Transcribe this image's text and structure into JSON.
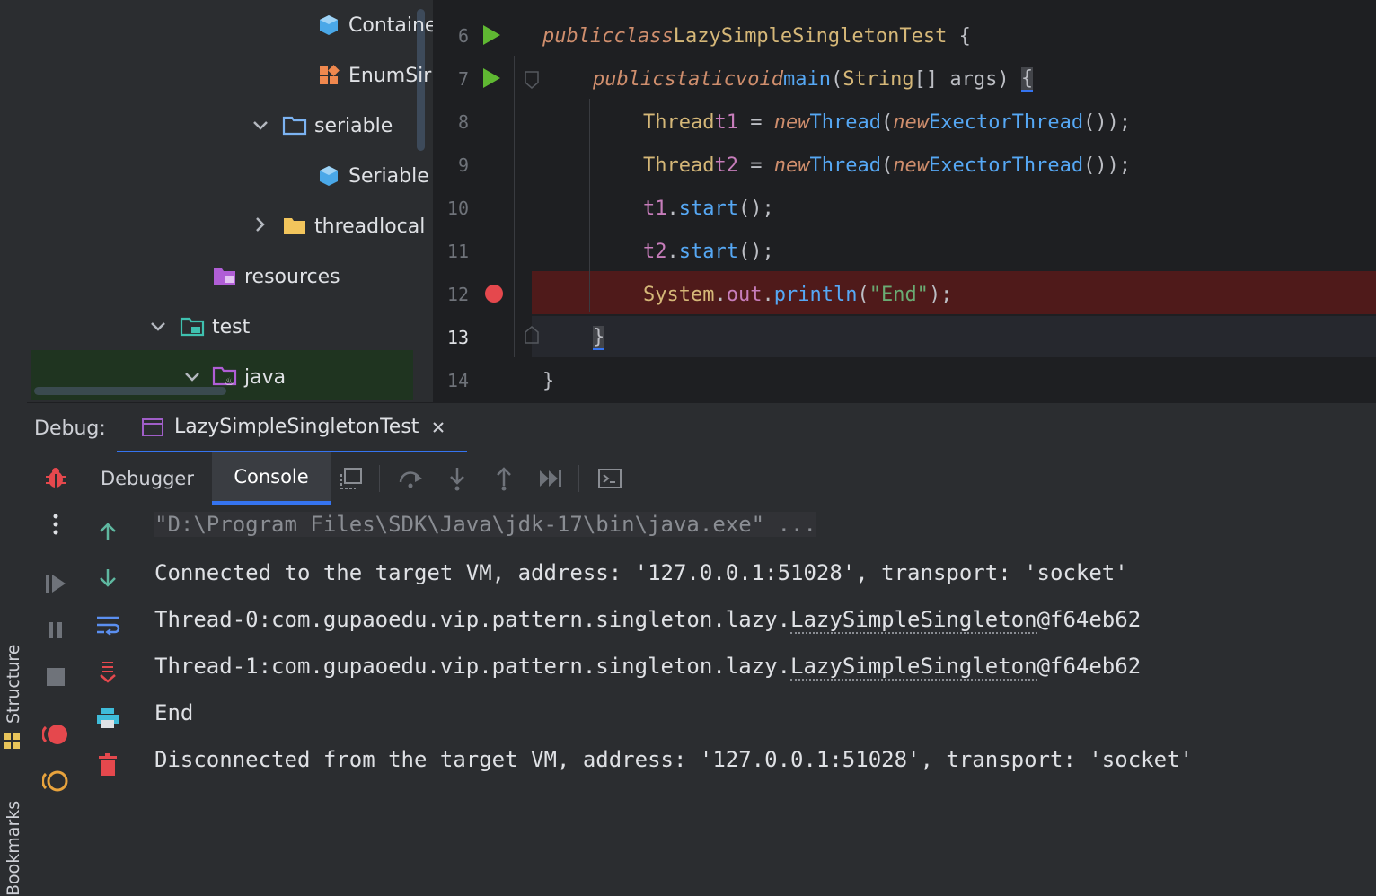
{
  "sidebar_stripe": {
    "structure_label": "Structure",
    "bookmarks_label": "Bookmarks"
  },
  "project_tree": {
    "items": [
      {
        "label": "Containe",
        "icon": "class-cube-icon"
      },
      {
        "label": "EnumSir",
        "icon": "enum-icon"
      },
      {
        "label": "seriable",
        "icon": "package-folder-icon"
      },
      {
        "label": "Seriable",
        "icon": "class-cube-icon"
      },
      {
        "label": "threadlocal",
        "icon": "folder-icon"
      },
      {
        "label": "resources",
        "icon": "resources-folder-icon"
      },
      {
        "label": "test",
        "icon": "test-folder-icon"
      },
      {
        "label": "java",
        "icon": "java-source-folder-icon"
      }
    ]
  },
  "editor": {
    "line_numbers": [
      "6",
      "7",
      "8",
      "9",
      "10",
      "11",
      "12",
      "13",
      "14"
    ],
    "lines": {
      "l6": {
        "kw1": "public",
        "kw2": "class",
        "name": "LazySimpleSingletonTest",
        "rest": " {"
      },
      "l7": {
        "kw1": "public",
        "kw2": "static",
        "kw3": "void",
        "fn": "main",
        "p1": "(",
        "type": "String",
        "p2": "[] args) ",
        "brace": "{"
      },
      "l8": {
        "type": "Thread",
        "var": "t1",
        "eq": " = ",
        "new1": "new",
        "ctor": "Thread",
        "p1": "(",
        "new2": "new",
        "arg": "ExectorThread",
        "p2": "());"
      },
      "l9": {
        "type": "Thread",
        "var": "t2",
        "eq": " = ",
        "new1": "new",
        "ctor": "Thread",
        "p1": "(",
        "new2": "new",
        "arg": "ExectorThread",
        "p2": "());"
      },
      "l10": {
        "var": "t1",
        "dot": ".",
        "fn": "start",
        "rest": "();"
      },
      "l11": {
        "var": "t2",
        "dot": ".",
        "fn": "start",
        "rest": "();"
      },
      "l12": {
        "cls": "System",
        "dot1": ".",
        "field": "out",
        "dot2": ".",
        "fn": "println",
        "p1": "(",
        "str": "\"End\"",
        "p2": ");"
      },
      "l13": {
        "brace": "}"
      },
      "l14": {
        "brace": "}"
      }
    }
  },
  "debug": {
    "label": "Debug:",
    "tab_label": "LazySimpleSingletonTest",
    "tabs": [
      "Debugger",
      "Console"
    ],
    "active_tab": "Console"
  },
  "console": {
    "command": "\"D:\\Program Files\\SDK\\Java\\jdk-17\\bin\\java.exe\" ...",
    "connected": "Connected to the target VM, address: '127.0.0.1:51028', transport: 'socket'",
    "thread0_prefix": "Thread-0:com.gupaoedu.vip.pattern.singleton.lazy.",
    "thread0_class": "LazySimpleSingleton",
    "thread0_hash": "@f64eb62",
    "thread1_prefix": "Thread-1:com.gupaoedu.vip.pattern.singleton.lazy.",
    "thread1_class": "LazySimpleSingleton",
    "thread1_hash": "@f64eb62",
    "end": "End",
    "disconnected": "Disconnected from the target VM, address: '127.0.0.1:51028', transport: 'socket'"
  },
  "colors": {
    "background": "#2b2d30",
    "editor_bg": "#1e1f22",
    "breakpoint_line": "#4f1a1a",
    "accent": "#3574f0",
    "keyword": "#cf8e6d",
    "function": "#56a8f5",
    "string": "#6aab73"
  }
}
